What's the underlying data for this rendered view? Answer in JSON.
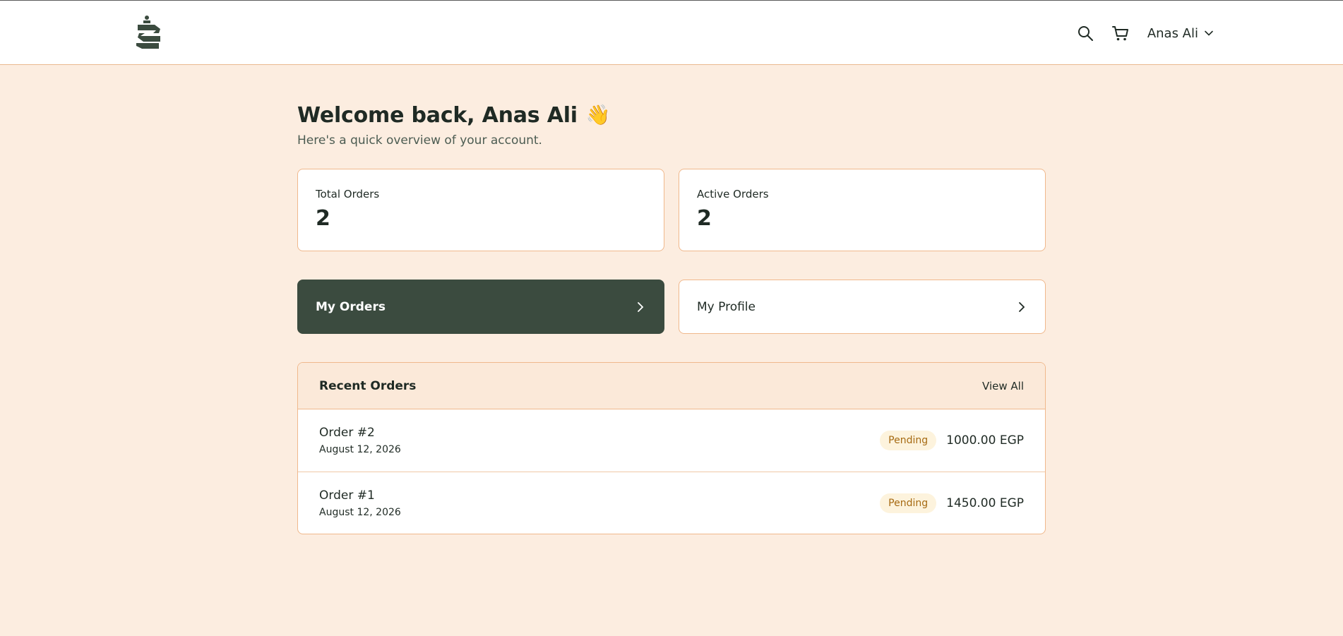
{
  "header": {
    "user_name": "Anas Ali"
  },
  "welcome": {
    "title": "Welcome back, Anas Ali",
    "emoji": "👋",
    "subtitle": "Here's a quick overview of your account."
  },
  "stats": [
    {
      "label": "Total Orders",
      "value": "2"
    },
    {
      "label": "Active Orders",
      "value": "2"
    }
  ],
  "actions": [
    {
      "label": "My Orders"
    },
    {
      "label": "My Profile"
    }
  ],
  "recent_orders": {
    "title": "Recent Orders",
    "view_all_label": "View All",
    "orders": [
      {
        "name": "Order #2",
        "date": "August 12, 2026",
        "status": "Pending",
        "total": "1000.00 EGP"
      },
      {
        "name": "Order #1",
        "date": "August 12, 2026",
        "status": "Pending",
        "total": "1450.00 EGP"
      }
    ]
  },
  "colors": {
    "background": "#fcede0",
    "primary": "#3b4b3f",
    "border": "#f0b88c",
    "badge_bg": "#fdf3dd",
    "badge_text": "#a66a12"
  }
}
